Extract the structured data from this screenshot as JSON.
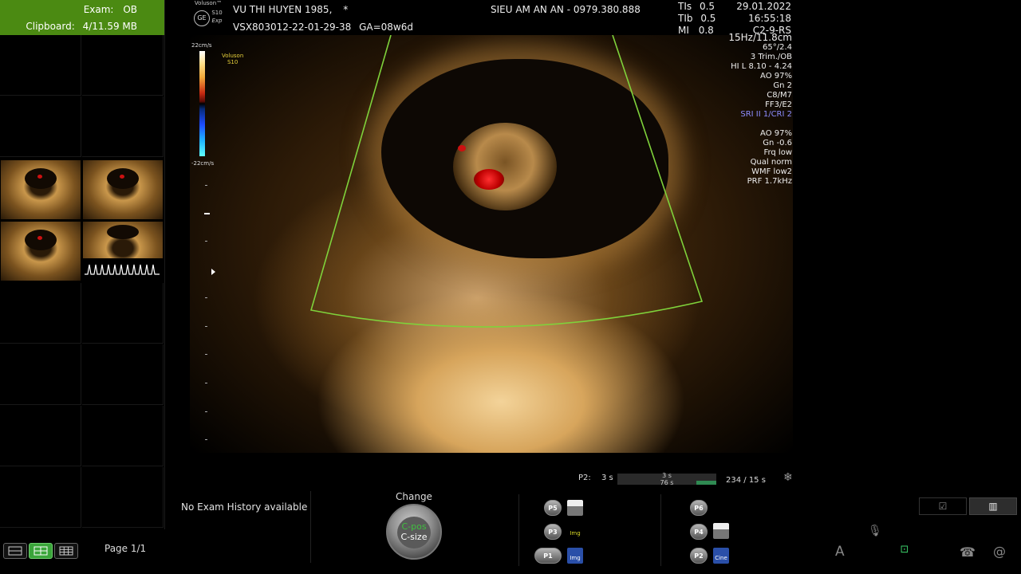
{
  "exam": {
    "label": "Exam:",
    "value": "OB"
  },
  "clipboard": {
    "label": "Clipboard:",
    "value": "4/11.59 MB"
  },
  "pager": {
    "text": "Page 1/1"
  },
  "patient": {
    "name": "VU THI HUYEN 1985,",
    "flag": "*",
    "exam_id": "VSX803012-22-01-29-38",
    "ga": "GA=08w6d"
  },
  "clinic": {
    "name": "SIEU AM AN AN - 0979.380.888"
  },
  "device": {
    "brand": "Voluson™",
    "model": "S10",
    "edition": "Exp",
    "ge": "GE"
  },
  "safety": {
    "tis_label": "TIs",
    "tis": "0.5",
    "tib_label": "TIb",
    "tib": "0.5",
    "mi_label": "MI",
    "mi": "0.8"
  },
  "session": {
    "date": "29.01.2022",
    "time": "16:55:18",
    "probe": "C2-9-RS"
  },
  "params": [
    {
      "text": "15Hz/11.8cm",
      "style": "big"
    },
    {
      "text": "65°/2.4"
    },
    {
      "text": "3 Trim./OB"
    },
    {
      "text": "HI L  8.10 - 4.24"
    },
    {
      "text": "AO 97%"
    },
    {
      "text": "Gn  2"
    },
    {
      "text": "C8/M7"
    },
    {
      "text": "FF3/E2"
    },
    {
      "text": "SRI II 1/CRI 2",
      "style": "hl"
    },
    {
      "text": ""
    },
    {
      "text": "AO 97%"
    },
    {
      "text": "Gn -0.6"
    },
    {
      "text": "Frq low"
    },
    {
      "text": "Qual norm"
    },
    {
      "text": "WMF low2"
    },
    {
      "text": "PRF  1.7kHz"
    }
  ],
  "colorbar": {
    "top": "22cm/s",
    "bottom": "-22cm/s",
    "brand": "Voluson",
    "model": "S10"
  },
  "cine": {
    "label": "P2:",
    "duration": "3 s",
    "track_top": "3 s",
    "track_bottom": "76 s",
    "fill_fraction": 0.2,
    "count": "234 / 15 s"
  },
  "history": {
    "text": "No Exam History available"
  },
  "knob": {
    "title": "Change",
    "line1": "C-pos",
    "line2": "C-size"
  },
  "pbuttons": [
    {
      "label": "P5",
      "icon_kind": "printer",
      "icon_text": ""
    },
    {
      "label": "P3",
      "icon_kind": "img",
      "icon_text": "Img"
    },
    {
      "label": "P1",
      "icon_kind": "floppy",
      "icon_text": "Img"
    },
    {
      "label": "P6",
      "icon_kind": "none",
      "icon_text": ""
    },
    {
      "label": "P4",
      "icon_kind": "printer",
      "icon_text": ""
    },
    {
      "label": "P2",
      "icon_kind": "floppy",
      "icon_text": "Cine"
    }
  ],
  "right_toolbar": {
    "check_icon": "☑",
    "chart_icon": "▥",
    "mic_icon": "🎙",
    "font_icon": "A",
    "network_icon": "⊡",
    "phone_icon": "☎",
    "at_icon": "@",
    "snow_icon": "❄"
  }
}
